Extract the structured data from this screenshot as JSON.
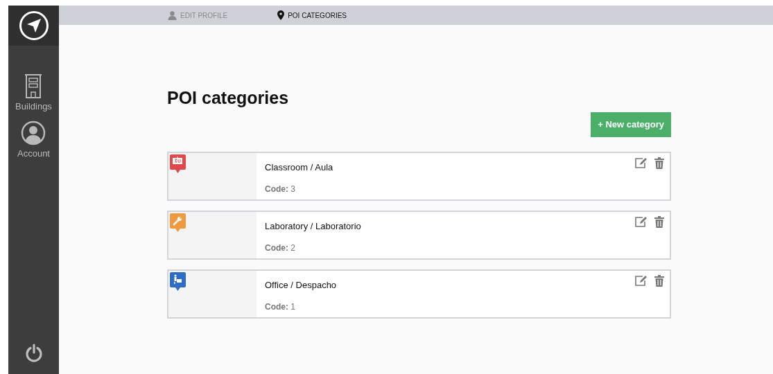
{
  "tabs": [
    {
      "label": "EDIT PROFILE",
      "selected": false
    },
    {
      "label": "POI CATEGORIES",
      "selected": true
    }
  ],
  "sidebar": {
    "items": [
      {
        "label": "Buildings",
        "kind": "building"
      },
      {
        "label": "Account",
        "kind": "account"
      }
    ]
  },
  "page": {
    "title": "POI categories",
    "new_button": "+ New category"
  },
  "categories": [
    {
      "name": "Classroom / Aula",
      "code_label": "Code:",
      "code": "3",
      "kind": "classroom",
      "color": "#e2474b"
    },
    {
      "name": "Laboratory / Laboratorio",
      "code_label": "Code:",
      "code": "2",
      "kind": "laboratory",
      "color": "#ef9a3f"
    },
    {
      "name": "Office / Despacho",
      "code_label": "Code:",
      "code": "1",
      "kind": "office",
      "color": "#2f6cc6"
    }
  ]
}
